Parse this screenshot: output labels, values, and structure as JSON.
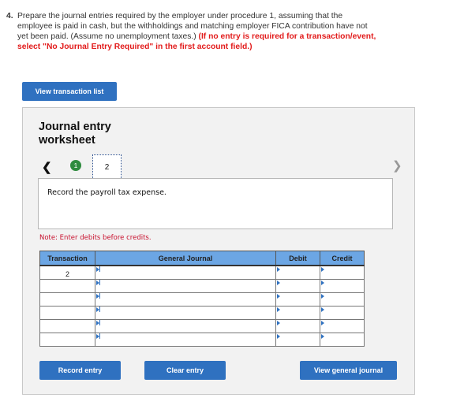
{
  "question": {
    "number": "4.",
    "text": "Prepare the journal entries required by the employer under procedure 1, assuming that the employee is paid in cash, but the withholdings and matching employer FICA contribution have not yet been paid. (Assume no unemployment taxes.) ",
    "instruction": "(If no entry is required for a transaction/event, select \"No Journal Entry Required\" in the first account field.)"
  },
  "buttons": {
    "view_transaction_list": "View transaction list",
    "record_entry": "Record entry",
    "clear_entry": "Clear entry",
    "view_general_journal": "View general journal"
  },
  "worksheet": {
    "title_line1": "Journal entry",
    "title_line2": "worksheet",
    "prev_icon": "‹",
    "next_icon": "›",
    "steps": [
      {
        "label": "1",
        "state": "completed"
      },
      {
        "label": "2",
        "state": "active"
      }
    ],
    "description": "Record the payroll tax expense.",
    "note": "Note: Enter debits before credits."
  },
  "table": {
    "headers": [
      "Transaction",
      "General Journal",
      "Debit",
      "Credit"
    ],
    "rows": [
      {
        "transaction": "2",
        "account": "",
        "debit": "",
        "credit": ""
      },
      {
        "transaction": "",
        "account": "",
        "debit": "",
        "credit": ""
      },
      {
        "transaction": "",
        "account": "",
        "debit": "",
        "credit": ""
      },
      {
        "transaction": "",
        "account": "",
        "debit": "",
        "credit": ""
      },
      {
        "transaction": "",
        "account": "",
        "debit": "",
        "credit": ""
      },
      {
        "transaction": "",
        "account": "",
        "debit": "",
        "credit": ""
      }
    ]
  },
  "colors": {
    "button": "#2f71c0",
    "header": "#6ca6e4",
    "step_completed": "#2e8b3e",
    "instruction_red": "#e21b1b",
    "note_red": "#c8102e"
  }
}
